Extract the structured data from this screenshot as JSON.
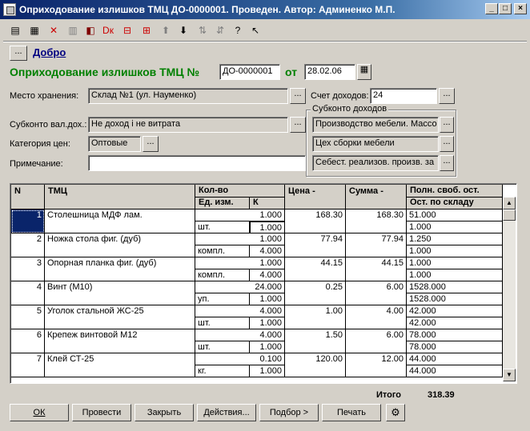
{
  "window": {
    "title": "Оприходование излишков ТМЦ ДО-0000001. Проведен. Автор: Админенко М.П.",
    "minimize": "_",
    "maximize": "□",
    "close": "×"
  },
  "toolbar": {
    "icons": [
      "new-doc-icon",
      "copy-doc-icon",
      "delete-doc-icon",
      "edit-doc-icon",
      "post-doc-icon",
      "unpost-doc-icon",
      "journal-icon",
      "move-up-icon",
      "move-down-icon",
      "sort-asc-icon",
      "sort-desc-icon",
      "help-icon",
      "context-help-icon"
    ]
  },
  "header": {
    "dots_label": "...",
    "link_label": "Добро",
    "doc_title": "Оприходование излишков ТМЦ №",
    "doc_number": "ДО-0000001",
    "date_label": "от",
    "date_value": "28.02.06"
  },
  "form": {
    "storage_label": "Место хранения:",
    "storage_value": "Склад №1 (ул. Науменко)",
    "subconto_label": "Субконто вал.дох.:",
    "subconto_value": "Не доход і не витрата",
    "price_cat_label": "Категория цен:",
    "price_cat_value": "Оптовые",
    "note_label": "Примечание:",
    "note_value": "",
    "income_account_label": "Счет доходов:",
    "income_account_value": "24",
    "income_group_label": "Субконто доходов",
    "income_sub1": "Производство мебели. Массо",
    "income_sub2": "Цех сборки мебели",
    "income_sub3": "Себест. реализов. произв. за",
    "btn_dots": "..."
  },
  "table": {
    "headers": {
      "n": "N",
      "tmc": "ТМЦ",
      "qty": "Кол-во",
      "unit": "Ед. изм.",
      "k": "К",
      "price": "Цена -",
      "sum": "Сумма -",
      "free": "Полн. своб. ост.",
      "stock": "Ост. по складу"
    },
    "rows": [
      {
        "n": "1",
        "name": "Столешница МДФ лам.",
        "qty": "1.000",
        "unit": "шт.",
        "k": "1.000",
        "price": "168.30",
        "sum": "168.30",
        "free": "51.000",
        "stock": "1.000"
      },
      {
        "n": "2",
        "name": "Ножка стола фиг. (дуб)",
        "qty": "1.000",
        "unit": "компл.",
        "k": "4.000",
        "price": "77.94",
        "sum": "77.94",
        "free": "1.250",
        "stock": "1.000"
      },
      {
        "n": "3",
        "name": "Опорная планка фиг. (дуб)",
        "qty": "1.000",
        "unit": "компл.",
        "k": "4.000",
        "price": "44.15",
        "sum": "44.15",
        "free": "1.000",
        "stock": "1.000"
      },
      {
        "n": "4",
        "name": "Винт (М10)",
        "qty": "24.000",
        "unit": "уп.",
        "k": "1.000",
        "price": "0.25",
        "sum": "6.00",
        "free": "1528.000",
        "stock": "1528.000"
      },
      {
        "n": "5",
        "name": "Уголок стальной ЖС-25",
        "qty": "4.000",
        "unit": "шт.",
        "k": "1.000",
        "price": "1.00",
        "sum": "4.00",
        "free": "42.000",
        "stock": "42.000"
      },
      {
        "n": "6",
        "name": "Крепеж винтовой М12",
        "qty": "4.000",
        "unit": "шт.",
        "k": "1.000",
        "price": "1.50",
        "sum": "6.00",
        "free": "78.000",
        "stock": "78.000"
      },
      {
        "n": "7",
        "name": "Клей СТ-25",
        "qty": "0.100",
        "unit": "кг.",
        "k": "1.000",
        "price": "120.00",
        "sum": "12.00",
        "free": "44.000",
        "stock": "44.000"
      }
    ]
  },
  "totals": {
    "label": "Итого",
    "value": "318.39"
  },
  "buttons": {
    "ok": "ОК",
    "post": "Провести",
    "close": "Закрыть",
    "actions": "Действия...",
    "pick": "Подбор >",
    "print": "Печать"
  }
}
